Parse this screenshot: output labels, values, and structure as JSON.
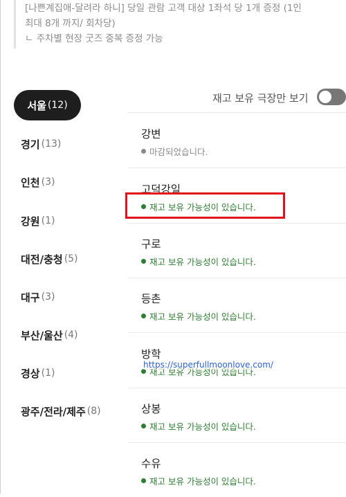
{
  "notice": {
    "line1": "[나쁜계집애-달려라 하니] 당일 관람 고객 대상 1좌석 당 1개 증정 (1인",
    "line2": "최대 8개 까지/ 회차당)",
    "line3": "ㄴ 주차별 현장 굿즈 중복 증정 가능"
  },
  "filter": {
    "label": "재고 보유 극장만 보기",
    "toggle_on": false
  },
  "regions": [
    {
      "name": "서울",
      "count": "(12)",
      "selected": true
    },
    {
      "name": "경기",
      "count": "(13)"
    },
    {
      "name": "인천",
      "count": "(3)"
    },
    {
      "name": "강원",
      "count": "(1)"
    },
    {
      "name": "대전/충청",
      "count": "(5)"
    },
    {
      "name": "대구",
      "count": "(3)"
    },
    {
      "name": "부산/울산",
      "count": "(4)"
    },
    {
      "name": "경상",
      "count": "(1)"
    },
    {
      "name": "광주/전라/제주",
      "count": "(8)"
    }
  ],
  "theaters": [
    {
      "name": "강변",
      "status": "마감되었습니다.",
      "state": "closed"
    },
    {
      "name": "고덕강일",
      "status": "재고 보유 가능성이 있습니다.",
      "state": "ok",
      "highlighted": true
    },
    {
      "name": "구로",
      "status": "재고 보유 가능성이 있습니다.",
      "state": "ok"
    },
    {
      "name": "등촌",
      "status": "재고 보유 가능성이 있습니다.",
      "state": "ok"
    },
    {
      "name": "방학",
      "status": "재고 보유 가능성이 있습니다.",
      "state": "ok"
    },
    {
      "name": "상봉",
      "status": "재고 보유 가능성이 있습니다.",
      "state": "ok"
    },
    {
      "name": "수유",
      "status": "재고 보유 가능성이 있습니다.",
      "state": "ok"
    }
  ],
  "watermark": "https://superfullmoonlove.com/",
  "colors": {
    "available": "#2e7d32",
    "closed": "#8a8a8a",
    "active_region_bg": "#1e1e1e",
    "highlight_box": "#e0111b"
  }
}
